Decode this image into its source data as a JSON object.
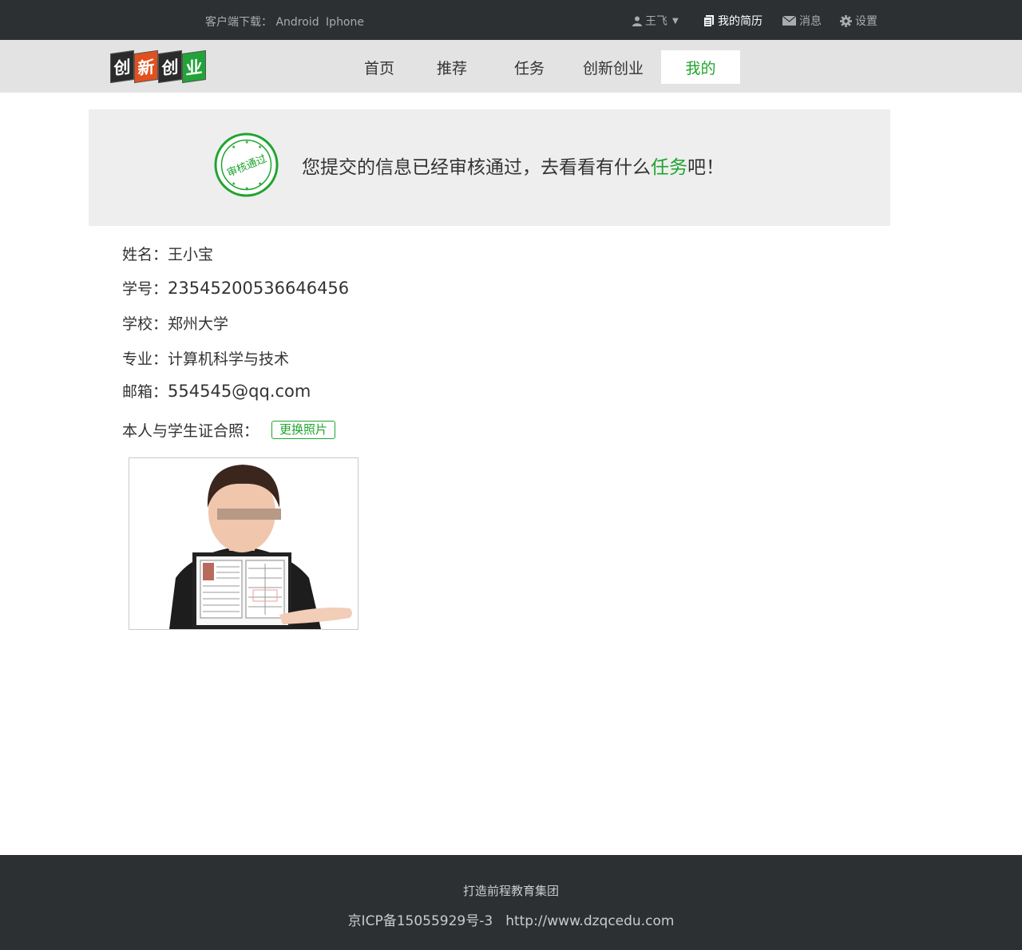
{
  "topbar": {
    "download_label": "客户端下载：",
    "android": "Android",
    "iphone": "Iphone",
    "user_name": "王飞",
    "user_caret": "▼",
    "resume": "我的简历",
    "messages": "消息",
    "settings": "设置"
  },
  "logo": {
    "chars": [
      "创",
      "新",
      "创",
      "业"
    ],
    "colors": [
      "#2b2b2b",
      "#e1501e",
      "#2b2b2b",
      "#22a33a"
    ]
  },
  "nav": {
    "items": [
      {
        "label": "首页",
        "active": false
      },
      {
        "label": "推荐",
        "active": false
      },
      {
        "label": "任务",
        "active": false
      },
      {
        "label": "创新创业",
        "active": false
      },
      {
        "label": "我的",
        "active": true
      }
    ]
  },
  "banner": {
    "stamp_text": "审核通过",
    "text_before": "您提交的信息已经审核通过，去看看有什么",
    "link": "任务",
    "text_after": "吧！"
  },
  "profile": {
    "name_label": "姓名：",
    "name": "王小宝",
    "id_label": "学号：",
    "id": "23545200536646456",
    "school_label": "学校：",
    "school": "郑州大学",
    "major_label": "专业：",
    "major": "计算机科学与技术",
    "email_label": "邮箱：",
    "email": "554545@qq.com",
    "photo_label": "本人与学生证合照：",
    "change_photo": "更换照片"
  },
  "footer": {
    "line1": "打造前程教育集团",
    "icp": "京ICP备15055929号-3",
    "url": "http://www.dzqcedu.com"
  },
  "colors": {
    "accent": "#20a42e",
    "topbar_bg": "#2d3033",
    "navbar_bg": "#e3e3e3",
    "banner_bg": "#eeeeee"
  }
}
